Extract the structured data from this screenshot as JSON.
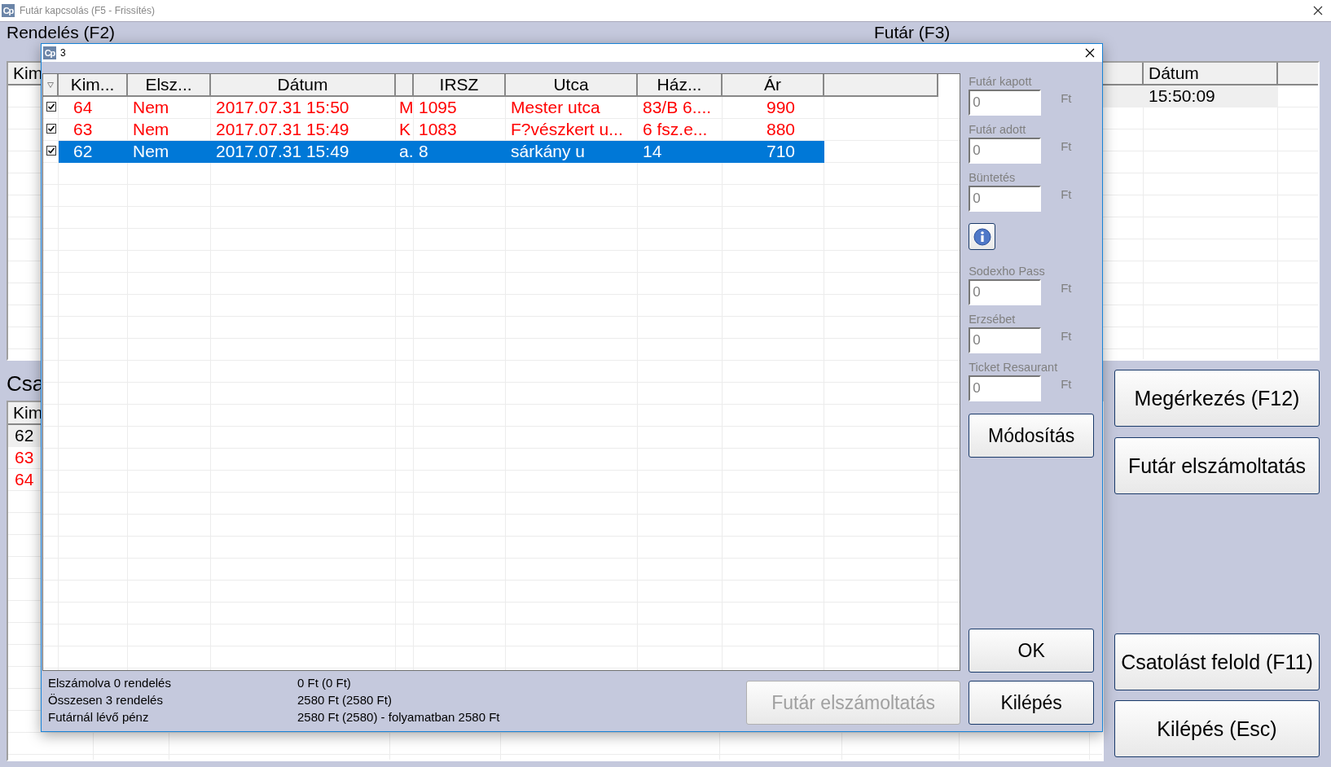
{
  "window": {
    "icon_text": "Cp",
    "title": "Futár kapcsolás (F5 - Frissítés)"
  },
  "orders": {
    "heading": "Rendelés (F2)",
    "columns": [
      "Kim"
    ]
  },
  "courier": {
    "heading": "Futár (F3)",
    "columns": [
      "Dátum"
    ],
    "rows": [
      {
        "time": "15:50:09",
        "selected": true
      }
    ]
  },
  "attached": {
    "heading": "Csa",
    "columns": [
      "Kim"
    ],
    "rows": [
      {
        "id": "62",
        "color": "#000000",
        "selected": true
      },
      {
        "id": "63",
        "color": "#ff0000",
        "selected": false
      },
      {
        "id": "64",
        "color": "#ff0000",
        "selected": false
      }
    ]
  },
  "top_buttons": [
    {
      "label": "Megérkezés (F12)"
    },
    {
      "label": "Futár elszámoltatás"
    }
  ],
  "bottom_buttons": [
    {
      "label": "Csatolást felold (F11)"
    },
    {
      "label": "Kilépés (Esc)"
    }
  ],
  "dialog": {
    "icon_text": "Cp",
    "title": "3",
    "sort_indicator": true,
    "columns": [
      {
        "kind": "text",
        "label": "Kim..."
      },
      {
        "kind": "text",
        "label": "Elsz..."
      },
      {
        "kind": "text",
        "label": "Dátum"
      },
      {
        "kind": "blank"
      },
      {
        "kind": "text",
        "label": "IRSZ"
      },
      {
        "kind": "text",
        "label": "Utca"
      },
      {
        "kind": "text",
        "label": "Ház..."
      },
      {
        "kind": "text",
        "label": "Ár"
      }
    ],
    "rows": [
      {
        "checked": true,
        "selected": false,
        "color": "#ff0000",
        "cells": [
          "64",
          "Nem",
          "2017.07.31 15:50",
          "M",
          "1095",
          "Mester utca",
          "83/B 6....",
          "990"
        ]
      },
      {
        "checked": true,
        "selected": false,
        "color": "#ff0000",
        "cells": [
          "63",
          "Nem",
          "2017.07.31 15:49",
          "K",
          "1083",
          "F?vészkert u...",
          "6 fsz.e...",
          "880"
        ]
      },
      {
        "checked": true,
        "selected": true,
        "cells": [
          "62",
          "Nem",
          "2017.07.31 15:49",
          "a.",
          "8",
          "sárkány u",
          "14",
          "710"
        ]
      }
    ],
    "side": [
      {
        "kind": "field",
        "label": "Futár kapott",
        "value": "0",
        "unit": "Ft"
      },
      {
        "kind": "field",
        "label": "Futár adott",
        "value": "0",
        "unit": "Ft"
      },
      {
        "kind": "field",
        "label": "Büntetés",
        "value": "0",
        "unit": "Ft"
      },
      {
        "kind": "info-button"
      },
      {
        "kind": "field",
        "label": "Sodexho Pass",
        "value": "0",
        "unit": "Ft"
      },
      {
        "kind": "field",
        "label": "Erzsébet",
        "value": "0",
        "unit": "Ft"
      },
      {
        "kind": "field",
        "label": "Ticket Resaurant",
        "value": "0",
        "unit": "Ft"
      }
    ],
    "modify_button": {
      "label": "Módosítás"
    },
    "confirm_buttons": [
      {
        "label": "OK"
      },
      {
        "label": "Kilépés"
      }
    ],
    "summary": [
      {
        "label": "Elszámolva 0 rendelés",
        "value": "0 Ft (0 Ft)"
      },
      {
        "label": "Összesen 3 rendelés",
        "value": "2580 Ft (2580 Ft)"
      },
      {
        "label": "Futárnál lévő pénz",
        "value": "2580 Ft (2580) - folyamatban 2580 Ft"
      }
    ],
    "settle_button": {
      "label": "Futár elszámoltatás",
      "disabled": true
    }
  }
}
